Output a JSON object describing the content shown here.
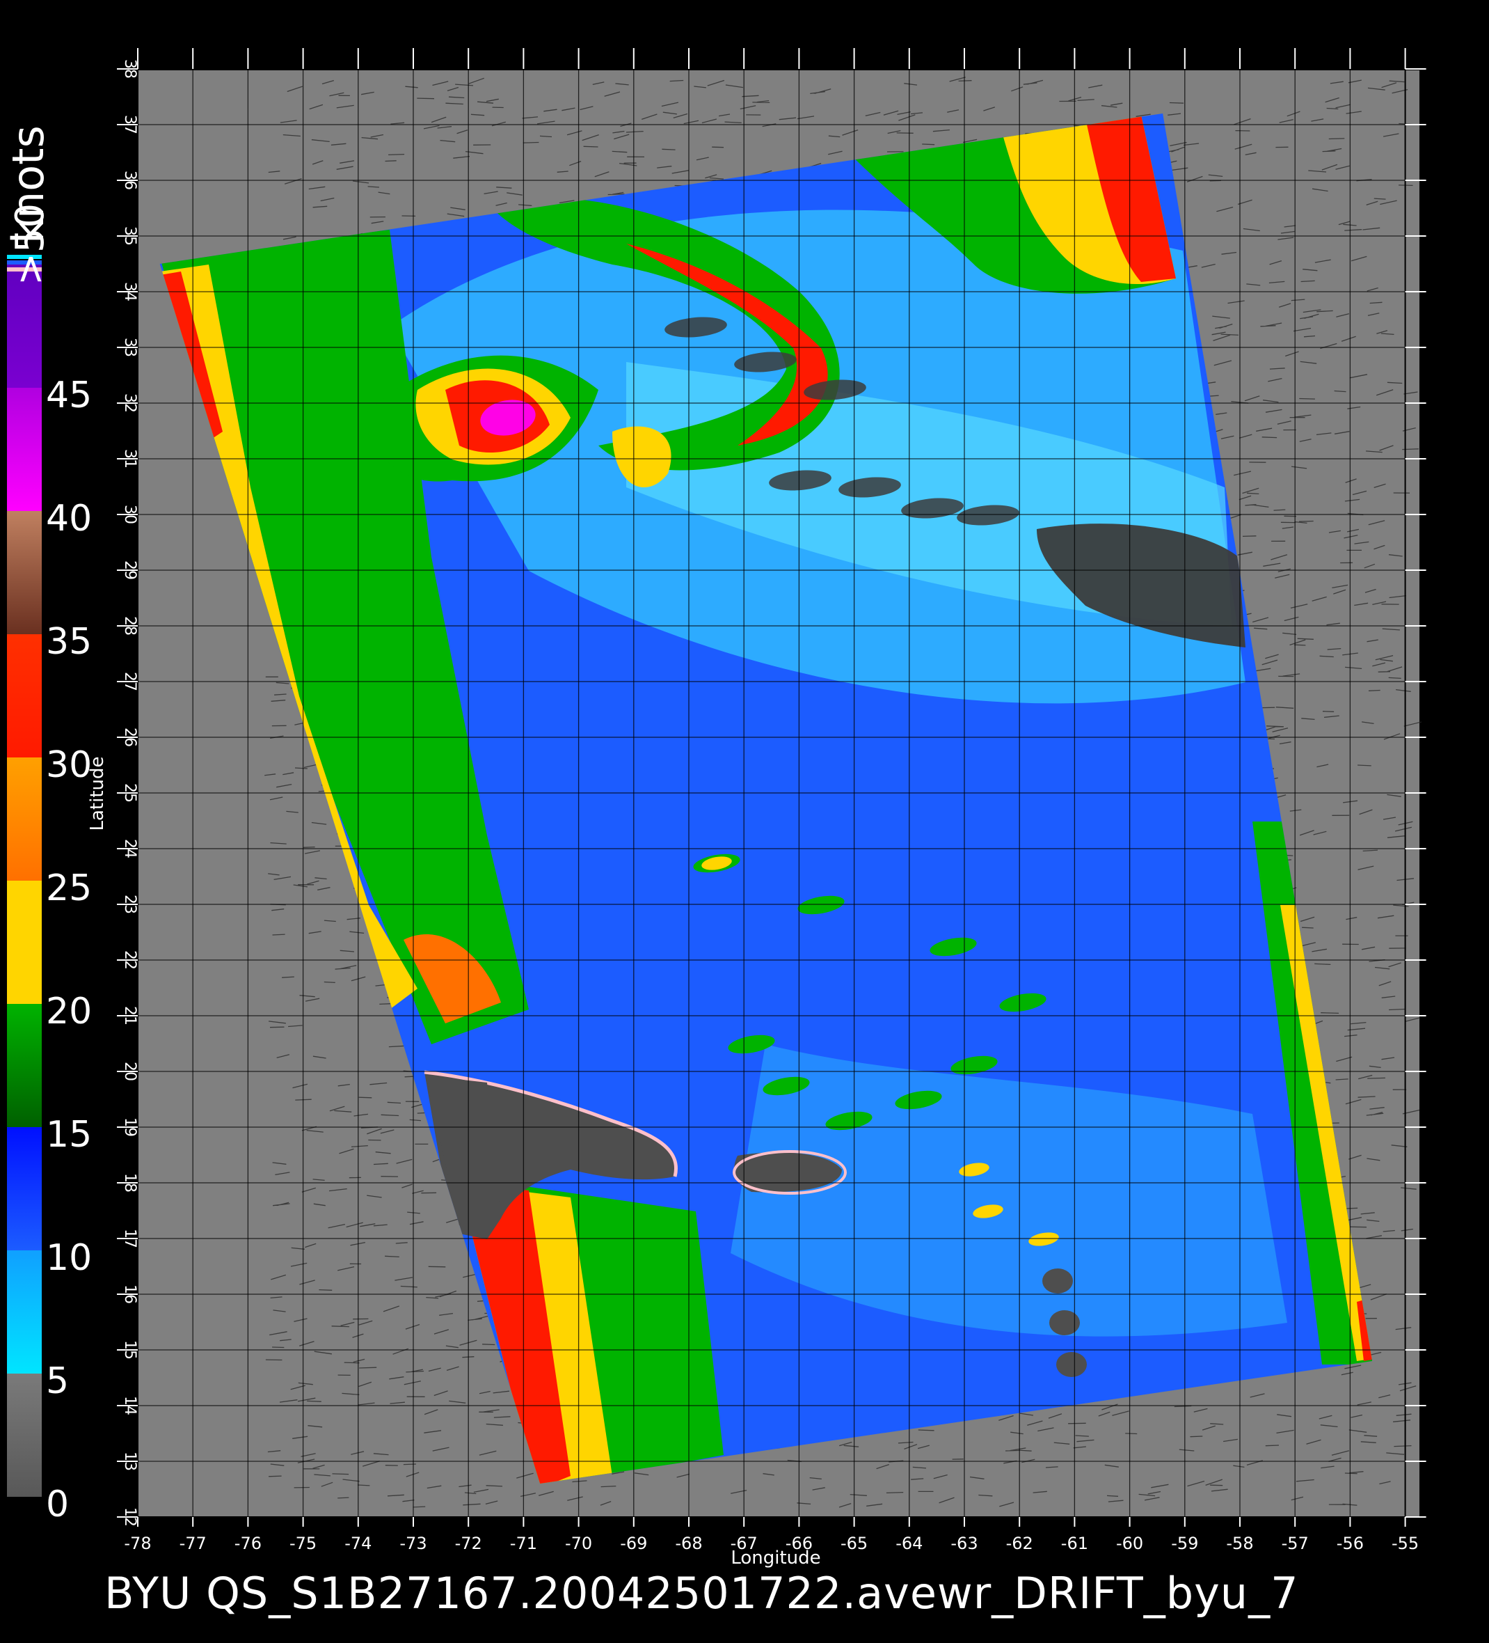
{
  "colorbar": {
    "unit_label": "knots",
    "over_label": ">50",
    "labels": [
      "0",
      "5",
      "10",
      "15",
      "20",
      "25",
      "30",
      "35",
      "40",
      "45"
    ],
    "colors": {
      "calm": "#585858",
      "cyan": "#00e5ff",
      "blue": "#1c5cff",
      "green": "#00b300",
      "yellow": "#ffd500",
      "orange": "#ff7000",
      "red": "#ff1a00",
      "brown": "#8a5040",
      "magenta": "#ff00ff",
      "purple": "#7a00d0",
      "pink": "#ffc0cb"
    }
  },
  "map": {
    "background_color": "#808080",
    "land_color": "#4e4e4e",
    "lon_ticks": [
      "-78",
      "-77",
      "-76",
      "-75",
      "-74",
      "-73",
      "-72",
      "-71",
      "-70",
      "-69",
      "-68",
      "-67",
      "-66",
      "-65",
      "-64",
      "-63",
      "-62",
      "-61",
      "-60",
      "-59",
      "-58",
      "-57",
      "-56",
      "-55"
    ],
    "lat_ticks": [
      "12",
      "13",
      "14",
      "15",
      "16",
      "17",
      "18",
      "19",
      "20",
      "21",
      "22",
      "23",
      "24",
      "25",
      "26",
      "27",
      "28",
      "29",
      "30",
      "31",
      "32",
      "33",
      "34",
      "35",
      "36",
      "37",
      "38"
    ],
    "xlabel": "Longitude",
    "ylabel": "Latitude"
  },
  "footer": {
    "title": "BYU  QS_S1B27167.20042501722.avewr_DRIFT_byu_7"
  }
}
